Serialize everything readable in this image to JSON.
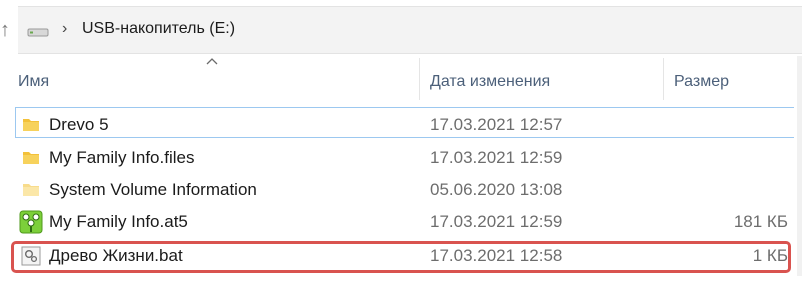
{
  "address_bar": {
    "path_label": "USB-накопитель (E:)"
  },
  "columns": {
    "name": "Имя",
    "date": "Дата изменения",
    "size": "Размер"
  },
  "files": [
    {
      "name": "Drevo 5",
      "date": "17.03.2021 12:57",
      "size": "",
      "icon": "folder-icon"
    },
    {
      "name": "My Family Info.files",
      "date": "17.03.2021 12:59",
      "size": "",
      "icon": "folder-icon"
    },
    {
      "name": "System Volume Information",
      "date": "05.06.2020 13:08",
      "size": "",
      "icon": "folder-faded-icon"
    },
    {
      "name": "My Family Info.at5",
      "date": "17.03.2021 12:59",
      "size": "181 КБ",
      "icon": "tree-app-file-icon"
    },
    {
      "name": "Древо Жизни.bat",
      "date": "17.03.2021 12:58",
      "size": "1 КБ",
      "icon": "batch-file-icon"
    }
  ],
  "colors": {
    "highlight_border": "#d9534f",
    "selection_border": "#9cc8f0",
    "folder_yellow": "#f3c13a"
  }
}
